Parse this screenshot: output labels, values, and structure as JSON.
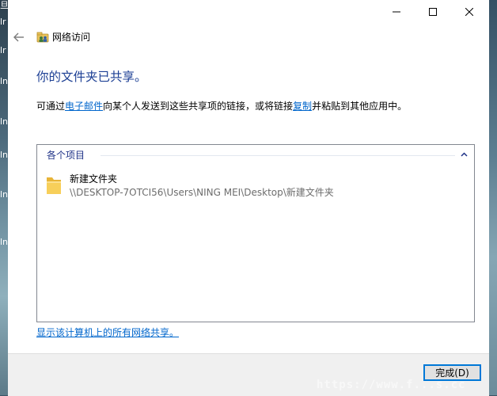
{
  "window": {
    "title": "网络访问"
  },
  "desktop": {
    "left_glyphs": [
      "旦",
      "lr",
      "lr",
      "ln",
      "ln",
      "ln",
      "ln",
      "ln"
    ]
  },
  "main": {
    "heading": "你的文件夹已共享。",
    "desc_before": "可通过",
    "email_link": "电子邮件",
    "desc_middle": "向某个人发送到这些共享项的链接，或将链接",
    "copy_link": "复制",
    "desc_after": "并粘贴到其他应用中。"
  },
  "items_panel": {
    "group_label": "各个项目",
    "items": [
      {
        "name": "新建文件夹",
        "path": "\\\\DESKTOP-7OTCI56\\Users\\NING MEI\\Desktop\\新建文件夹"
      }
    ]
  },
  "show_all_link": "显示该计算机上的所有网络共享。",
  "footer": {
    "finish_label": "完成(D)"
  },
  "watermark": "https://www.f...s.cc",
  "colors": {
    "heading": "#1c3f94",
    "link": "#0066cc",
    "group_label": "#1e3287",
    "button_border": "#0078d7"
  }
}
